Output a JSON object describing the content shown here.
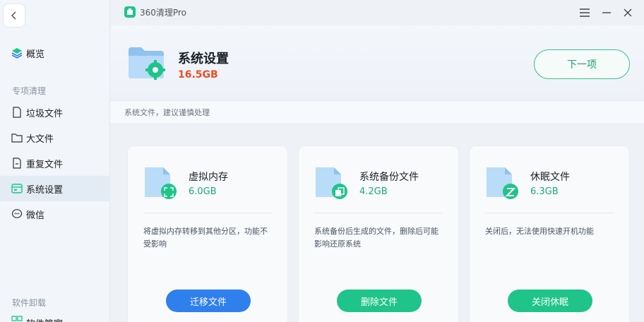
{
  "app": {
    "title": "360清理Pro"
  },
  "sidebar": {
    "overview": "概览",
    "section_special": "专项清理",
    "items": [
      {
        "label": "垃圾文件",
        "icon": "file-icon"
      },
      {
        "label": "大文件",
        "icon": "folder-icon"
      },
      {
        "label": "重复文件",
        "icon": "duplicate-file-icon"
      },
      {
        "label": "系统设置",
        "icon": "system-settings-icon",
        "active": true
      },
      {
        "label": "微信",
        "icon": "wechat-icon"
      }
    ],
    "section_uninstall": "软件卸载",
    "partial_item": "软件管家"
  },
  "header": {
    "title": "系统设置",
    "size": "16.5GB",
    "next_label": "下一项",
    "description": "系统文件，建议谨慎处理"
  },
  "cards": [
    {
      "title": "虚拟内存",
      "size": "6.0GB",
      "desc": "将虚拟内存转移到其他分区，功能不受影响",
      "button": "迁移文件",
      "button_color": "#2f80ed",
      "badge_icon": "expand-icon"
    },
    {
      "title": "系统备份文件",
      "size": "4.2GB",
      "desc": "系统备份后生成的文件，删除后可能影响还原系统",
      "button": "删除文件",
      "button_color": "#1fc48a",
      "badge_icon": "copy-icon"
    },
    {
      "title": "休眠文件",
      "size": "6.3GB",
      "desc": "关闭后，无法使用快速开机功能",
      "button": "关闭休眠",
      "button_color": "#1fc48a",
      "badge_icon": "sleep-z-icon"
    }
  ],
  "colors": {
    "accent_green": "#1fc48a",
    "accent_blue": "#2f80ed",
    "size_red": "#ef4b22"
  }
}
